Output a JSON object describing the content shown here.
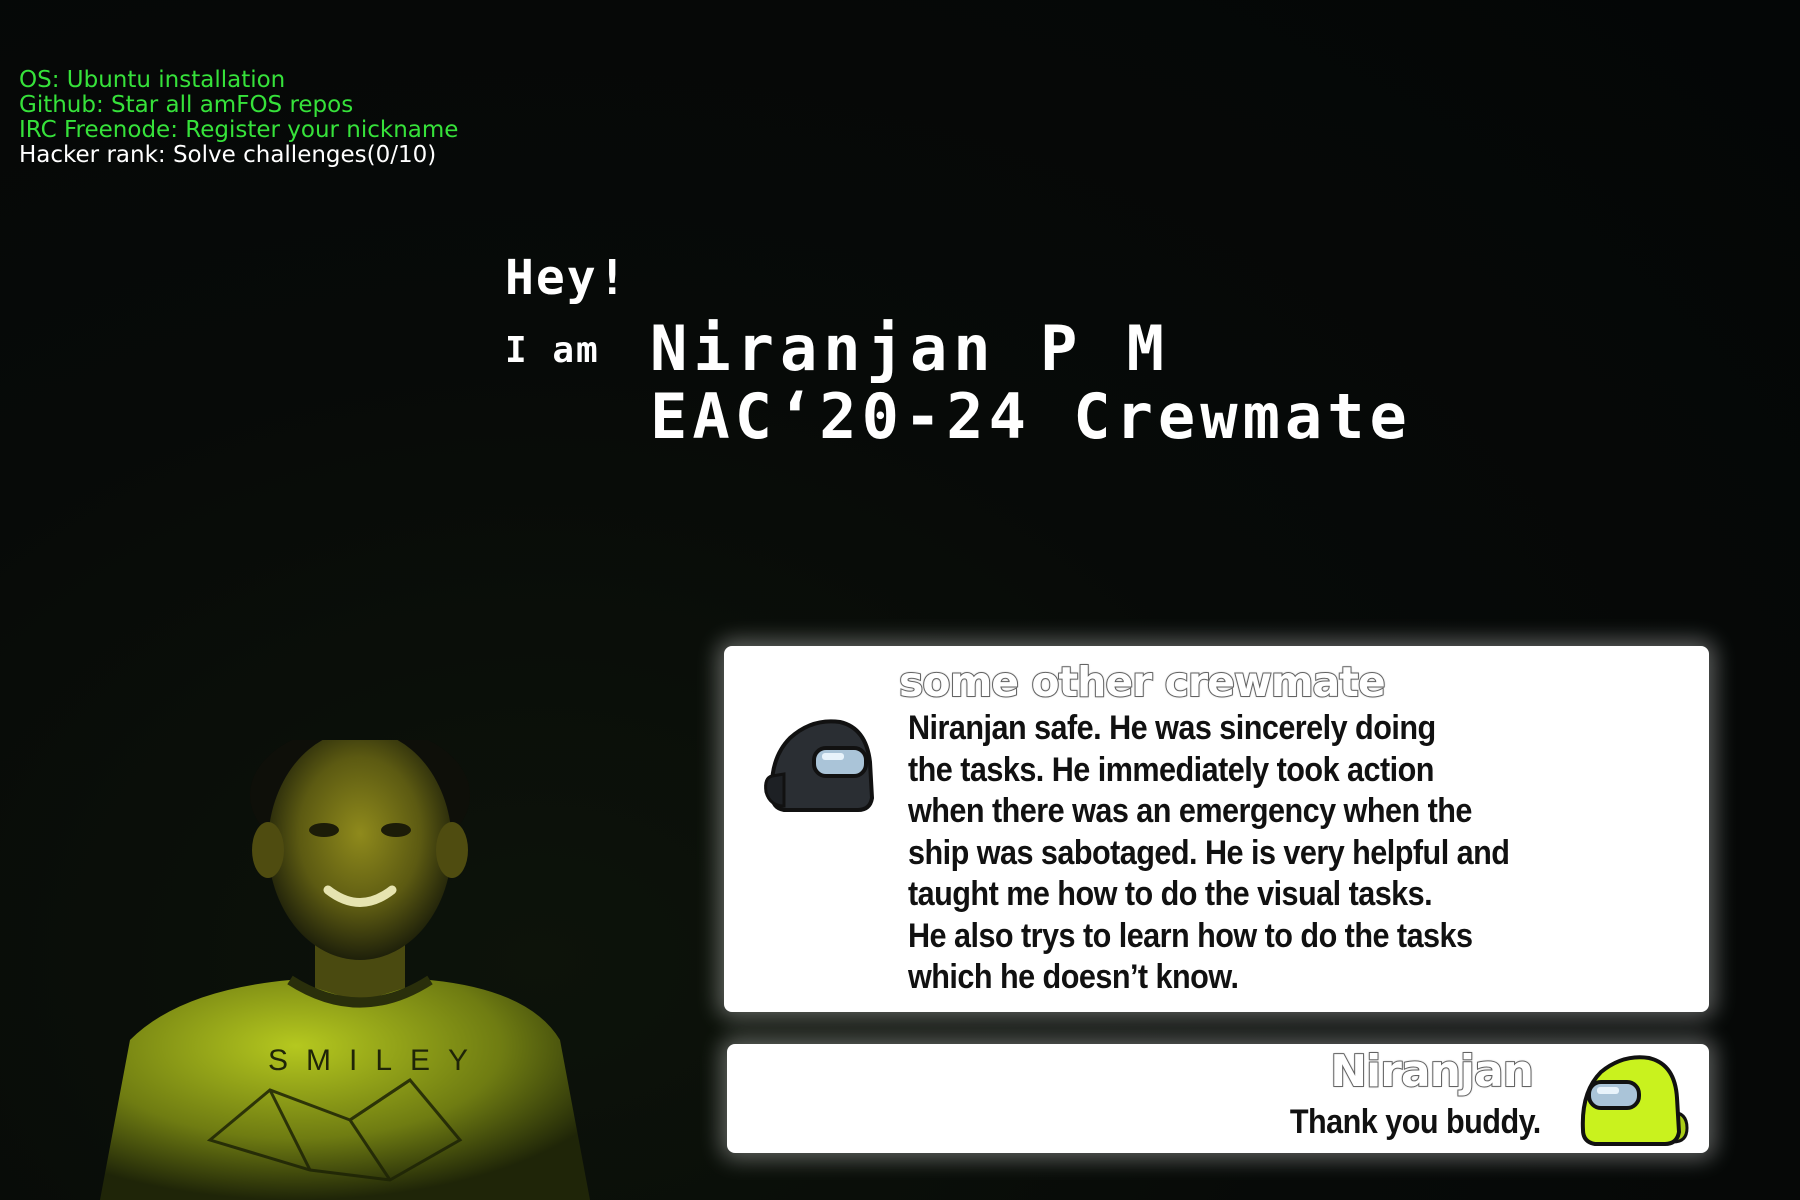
{
  "tasks": [
    {
      "text": "OS: Ubuntu installation",
      "status": "done"
    },
    {
      "text": "Github: Star all amFOS repos",
      "status": "done"
    },
    {
      "text": "IRC Freenode: Register your nickname",
      "status": "done"
    },
    {
      "text": "Hacker rank: Solve challenges(0/10)",
      "status": "pending"
    }
  ],
  "intro": {
    "greeting": "Hey!",
    "prefix": "I am",
    "name": "Niranjan P M",
    "role": "EAC‘20-24 Crewmate"
  },
  "portrait": {
    "shirt_text": "SMILEY",
    "icon": "person-photo"
  },
  "chat": [
    {
      "speaker": "some other crewmate",
      "avatar": "black-crewmate-icon",
      "avatar_color": "#2a2e33",
      "lines": [
        "Niranjan safe. He was sincerely doing",
        "the tasks. He immediately took action",
        "when there was an emergency when the",
        "ship was sabotaged. He is very helpful and",
        "taught me how to do the visual tasks.",
        "He also trys to learn how to do the tasks",
        "which he doesn’t know."
      ]
    },
    {
      "speaker": "Niranjan",
      "avatar": "lime-crewmate-icon",
      "avatar_color": "#c9f21e",
      "text": "Thank you buddy."
    }
  ],
  "colors": {
    "background": "#060908",
    "task_done": "#36e23a",
    "task_pending": "#ffffff",
    "portrait_tint": "#a6b91c"
  }
}
